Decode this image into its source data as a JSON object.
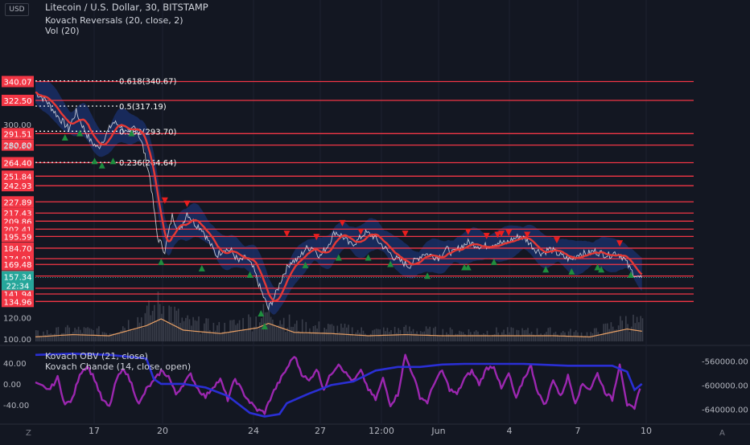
{
  "header": {
    "currency_button": "USD",
    "symbol_line": "Litecoin / U.S. Dollar, 30, BITSTAMP",
    "indicator_1": "Kovach Reversals (20, close, 2)",
    "indicator_2": "Vol (20)"
  },
  "lower_pane": {
    "indicator_1": "Kovach OBV (21, close)",
    "indicator_2": "Kovach Chande (14, close, open)"
  },
  "footer": {
    "left_icon_label": "Z",
    "right_icon_label": "A"
  },
  "colors": {
    "background": "#131722",
    "level_line": "#f23645",
    "price_line": "#e0e3eb",
    "ma_line": "#e53935",
    "band_fill": "#1e3a8a",
    "up_marker": "#1e8e3e",
    "down_marker": "#e91e1e",
    "volume_bar": "#3a3e4a",
    "volume_ma": "#e8a066",
    "obv_line": "#2a2fd4",
    "chande_line": "#9c27b0",
    "current_price_bg": "#26a69a"
  },
  "chart_data": [
    {
      "type": "line",
      "x_labels": [
        "17",
        "20",
        "24",
        "27",
        "12:00",
        "Jun",
        "4",
        "7",
        "10"
      ],
      "y_ticks": [
        100,
        120,
        140,
        160,
        180,
        200,
        220,
        240,
        260,
        280,
        300,
        320
      ],
      "y_tick_labels": [
        "100.00",
        "120.00",
        "",
        "",
        "",
        "",
        "",
        "",
        "",
        "280.00",
        "300.00",
        ""
      ],
      "ylim": [
        100,
        345
      ],
      "levels": [
        340.07,
        322.5,
        291.51,
        280.8,
        264.4,
        251.84,
        242.93,
        227.89,
        217.43,
        209.86,
        202.41,
        195.59,
        184.7,
        174.91,
        169.48,
        158.69,
        147.29,
        141.94,
        134.96
      ],
      "level_labels": [
        "340.07",
        "322.50",
        "291.51",
        "280.80",
        "264.40",
        "251.84",
        "242.93",
        "227.89",
        "217.43",
        "209.86",
        "202.41",
        "195.59",
        "184.70",
        "174.91",
        "169.48",
        "158.69",
        "147.29",
        "141.94",
        "134.96"
      ],
      "current_price": {
        "value": 157.34,
        "label": "157.34",
        "countdown": "22:34"
      },
      "fibonacci": [
        {
          "value": 340.67,
          "label": "0.618(340.67)"
        },
        {
          "value": 317.19,
          "label": "0.5(317.19)"
        },
        {
          "value": 293.7,
          "label": "0.382(293.70)"
        },
        {
          "value": 264.64,
          "label": "0.236(264.64)"
        }
      ],
      "price_anchors": [
        [
          0,
          330
        ],
        [
          3,
          322
        ],
        [
          6,
          308
        ],
        [
          9,
          296
        ],
        [
          11,
          312
        ],
        [
          13,
          297
        ],
        [
          15,
          284
        ],
        [
          17,
          278
        ],
        [
          19,
          290
        ],
        [
          21,
          302
        ],
        [
          23,
          299
        ],
        [
          25,
          290
        ],
        [
          27,
          300
        ],
        [
          29,
          280
        ],
        [
          31,
          250
        ],
        [
          33,
          195
        ],
        [
          35,
          182
        ],
        [
          37,
          215
        ],
        [
          39,
          200
        ],
        [
          41,
          218
        ],
        [
          43,
          208
        ],
        [
          45,
          203
        ],
        [
          47,
          190
        ],
        [
          49,
          178
        ],
        [
          51,
          184
        ],
        [
          53,
          182
        ],
        [
          55,
          172
        ],
        [
          57,
          176
        ],
        [
          59,
          165
        ],
        [
          61,
          145
        ],
        [
          63,
          128
        ],
        [
          65,
          142
        ],
        [
          67,
          160
        ],
        [
          69,
          172
        ],
        [
          71,
          174
        ],
        [
          73,
          184
        ],
        [
          75,
          186
        ],
        [
          77,
          177
        ],
        [
          79,
          187
        ],
        [
          81,
          200
        ],
        [
          83,
          196
        ],
        [
          85,
          188
        ],
        [
          87,
          191
        ],
        [
          89,
          199
        ],
        [
          91,
          197
        ],
        [
          93,
          190
        ],
        [
          95,
          183
        ],
        [
          97,
          176
        ],
        [
          99,
          172
        ],
        [
          101,
          168
        ],
        [
          103,
          174
        ],
        [
          105,
          180
        ],
        [
          107,
          178
        ],
        [
          109,
          176
        ],
        [
          111,
          184
        ],
        [
          113,
          180
        ],
        [
          115,
          186
        ],
        [
          117,
          190
        ],
        [
          119,
          188
        ],
        [
          121,
          186
        ],
        [
          123,
          188
        ],
        [
          125,
          190
        ],
        [
          127,
          189
        ],
        [
          129,
          193
        ],
        [
          131,
          196
        ],
        [
          133,
          192
        ],
        [
          135,
          184
        ],
        [
          137,
          180
        ],
        [
          139,
          184
        ],
        [
          141,
          180
        ],
        [
          143,
          176
        ],
        [
          145,
          174
        ],
        [
          147,
          180
        ],
        [
          149,
          179
        ],
        [
          151,
          182
        ],
        [
          153,
          180
        ],
        [
          155,
          178
        ],
        [
          157,
          181
        ],
        [
          159,
          176
        ],
        [
          161,
          164
        ],
        [
          163,
          157
        ],
        [
          164,
          157.34
        ]
      ],
      "up_markers": [
        [
          8,
          288
        ],
        [
          12,
          292
        ],
        [
          16,
          266
        ],
        [
          18,
          262
        ],
        [
          21,
          266
        ],
        [
          26,
          292
        ],
        [
          34,
          172
        ],
        [
          45,
          166
        ],
        [
          58,
          160
        ],
        [
          61,
          124
        ],
        [
          62,
          112
        ],
        [
          73,
          169
        ],
        [
          82,
          176
        ],
        [
          90,
          176
        ],
        [
          96,
          170
        ],
        [
          106,
          159
        ],
        [
          116,
          167
        ],
        [
          117,
          167
        ],
        [
          124,
          172
        ],
        [
          138,
          165
        ],
        [
          145,
          163
        ],
        [
          152,
          167
        ],
        [
          153,
          165
        ],
        [
          161,
          160
        ]
      ],
      "down_markers": [
        [
          35,
          229
        ],
        [
          41,
          226
        ],
        [
          68,
          198
        ],
        [
          76,
          195
        ],
        [
          83,
          208
        ],
        [
          88,
          200
        ],
        [
          100,
          198
        ],
        [
          117,
          200
        ],
        [
          122,
          196
        ],
        [
          125,
          197
        ],
        [
          126,
          198
        ],
        [
          128,
          199
        ],
        [
          133,
          197
        ],
        [
          141,
          192
        ],
        [
          158,
          189
        ]
      ],
      "x_range": [
        0,
        178
      ]
    },
    {
      "type": "bar",
      "name": "Vol (20)",
      "volume_anchors": [
        [
          0,
          0.2
        ],
        [
          10,
          0.3
        ],
        [
          20,
          0.25
        ],
        [
          30,
          0.7
        ],
        [
          34,
          1.0
        ],
        [
          40,
          0.5
        ],
        [
          50,
          0.35
        ],
        [
          60,
          0.6
        ],
        [
          63,
          0.8
        ],
        [
          70,
          0.4
        ],
        [
          80,
          0.35
        ],
        [
          90,
          0.25
        ],
        [
          100,
          0.3
        ],
        [
          110,
          0.25
        ],
        [
          120,
          0.25
        ],
        [
          130,
          0.25
        ],
        [
          140,
          0.25
        ],
        [
          150,
          0.2
        ],
        [
          160,
          0.55
        ],
        [
          164,
          0.45
        ]
      ]
    },
    {
      "type": "line",
      "name": "Kovach Chande (14, close, open)",
      "y_ticks": [
        60,
        40,
        20,
        0,
        -20,
        -40,
        -60
      ],
      "y_tick_labels": [
        "",
        "40.00",
        "",
        "0.00",
        "",
        "-40.00",
        ""
      ],
      "ylim": [
        -62,
        62
      ],
      "values": [
        [
          0,
          0
        ],
        [
          4,
          -10
        ],
        [
          6,
          12
        ],
        [
          8,
          -40
        ],
        [
          10,
          -30
        ],
        [
          12,
          20
        ],
        [
          14,
          35
        ],
        [
          16,
          10
        ],
        [
          18,
          -30
        ],
        [
          20,
          -45
        ],
        [
          22,
          10
        ],
        [
          24,
          30
        ],
        [
          26,
          0
        ],
        [
          28,
          -40
        ],
        [
          30,
          -10
        ],
        [
          32,
          5
        ],
        [
          34,
          25
        ],
        [
          36,
          15
        ],
        [
          38,
          -20
        ],
        [
          40,
          0
        ],
        [
          42,
          18
        ],
        [
          44,
          -10
        ],
        [
          46,
          -25
        ],
        [
          48,
          -5
        ],
        [
          50,
          8
        ],
        [
          52,
          -30
        ],
        [
          54,
          10
        ],
        [
          56,
          -15
        ],
        [
          58,
          -35
        ],
        [
          60,
          -50
        ],
        [
          62,
          -55
        ],
        [
          64,
          -20
        ],
        [
          66,
          5
        ],
        [
          68,
          30
        ],
        [
          70,
          55
        ],
        [
          72,
          20
        ],
        [
          74,
          5
        ],
        [
          76,
          30
        ],
        [
          78,
          -10
        ],
        [
          80,
          20
        ],
        [
          82,
          40
        ],
        [
          84,
          20
        ],
        [
          86,
          5
        ],
        [
          88,
          25
        ],
        [
          90,
          -10
        ],
        [
          92,
          -30
        ],
        [
          94,
          10
        ],
        [
          96,
          -40
        ],
        [
          98,
          -20
        ],
        [
          100,
          55
        ],
        [
          102,
          20
        ],
        [
          104,
          -25
        ],
        [
          106,
          -35
        ],
        [
          108,
          5
        ],
        [
          110,
          25
        ],
        [
          112,
          -10
        ],
        [
          114,
          -20
        ],
        [
          116,
          10
        ],
        [
          118,
          25
        ],
        [
          120,
          0
        ],
        [
          122,
          30
        ],
        [
          124,
          35
        ],
        [
          126,
          -10
        ],
        [
          128,
          20
        ],
        [
          130,
          -30
        ],
        [
          132,
          10
        ],
        [
          134,
          35
        ],
        [
          136,
          -20
        ],
        [
          138,
          -40
        ],
        [
          140,
          10
        ],
        [
          142,
          -25
        ],
        [
          144,
          15
        ],
        [
          146,
          -35
        ],
        [
          148,
          0
        ],
        [
          150,
          -10
        ],
        [
          152,
          20
        ],
        [
          154,
          -15
        ],
        [
          156,
          -30
        ],
        [
          158,
          40
        ],
        [
          160,
          -40
        ],
        [
          162,
          -50
        ],
        [
          164,
          10
        ]
      ]
    },
    {
      "type": "line",
      "name": "Kovach OBV (21, close)",
      "y_ticks": [
        -560000,
        -600000,
        -640000
      ],
      "y_tick_labels": [
        "-560000.00",
        "-600000.00",
        "-640000.00"
      ],
      "ylim": [
        -658000,
        -545000
      ],
      "values": [
        [
          0,
          -550000
        ],
        [
          10,
          -548000
        ],
        [
          20,
          -550000
        ],
        [
          30,
          -556000
        ],
        [
          32,
          -590000
        ],
        [
          34,
          -598000
        ],
        [
          40,
          -598000
        ],
        [
          46,
          -604000
        ],
        [
          52,
          -618000
        ],
        [
          58,
          -646000
        ],
        [
          62,
          -652000
        ],
        [
          66,
          -648000
        ],
        [
          68,
          -630000
        ],
        [
          74,
          -614000
        ],
        [
          80,
          -600000
        ],
        [
          86,
          -594000
        ],
        [
          92,
          -576000
        ],
        [
          98,
          -570000
        ],
        [
          104,
          -570000
        ],
        [
          110,
          -566000
        ],
        [
          116,
          -565000
        ],
        [
          126,
          -565000
        ],
        [
          132,
          -565000
        ],
        [
          136,
          -566000
        ],
        [
          144,
          -568000
        ],
        [
          150,
          -568000
        ],
        [
          156,
          -568000
        ],
        [
          160,
          -578000
        ],
        [
          162,
          -608000
        ],
        [
          164,
          -598000
        ]
      ]
    }
  ]
}
